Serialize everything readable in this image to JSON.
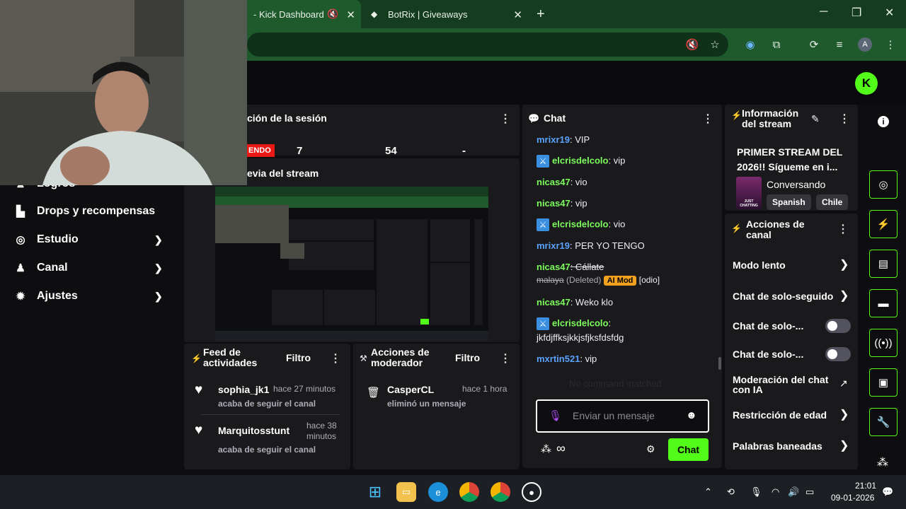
{
  "browser": {
    "tabs": [
      {
        "title": "- Kick Dashboard",
        "active": true
      },
      {
        "title": "BotRix | Giveaways",
        "active": false
      }
    ],
    "new_tab": "+",
    "avatar_letter": "A",
    "window_controls": {
      "minimize": "─",
      "maximize": "❐",
      "close": "✕"
    }
  },
  "kick": {
    "logo_letter": "K"
  },
  "sidebar": {
    "items": [
      {
        "label": "Logros",
        "icon": "trophy-icon"
      },
      {
        "label": "Drops y recompensas",
        "icon": "gift-icon"
      },
      {
        "label": "Estudio",
        "icon": "studio-icon"
      },
      {
        "label": "Canal",
        "icon": "user-icon"
      },
      {
        "label": "Ajustes",
        "icon": "gear-icon"
      }
    ]
  },
  "session": {
    "title": "ción de la sesión",
    "live_label": "ENDO",
    "stat1": "7",
    "stat2": "54",
    "stat3": "-"
  },
  "preview": {
    "title": "evia del stream"
  },
  "chat": {
    "title": "Chat",
    "messages": [
      {
        "user": "mrixr19",
        "text": ": VIP"
      },
      {
        "user": "elcrisdelcolo",
        "text": ": vip"
      },
      {
        "user": "nicas47",
        "text": ": vio"
      },
      {
        "user": "nicas47",
        "text": ": vip"
      },
      {
        "user": "elcrisdelcolo",
        "text": ": vio"
      },
      {
        "user": "mrixr19",
        "text": ": PER YO TENGO"
      },
      {
        "user": "nicas47",
        "text": ": Cállate"
      },
      {
        "deleted_text": "malaya",
        "deleted_label": "(Deleted)",
        "badge": "AI Mod",
        "reason": "[odio]"
      },
      {
        "user": "nicas47",
        "text": ": Weko klo"
      },
      {
        "user": "elcrisdelcolo",
        "text": ":"
      },
      {
        "text": "jkfdjffksjkkjsfjksfdsfdg"
      },
      {
        "user": "mxrtin521",
        "text": ": vip"
      }
    ],
    "faded_line": "No command matched",
    "input_placeholder": "Enviar un mensaje",
    "send_label": "Chat"
  },
  "feed": {
    "title_line1": "Feed de",
    "title_line2": "actividades",
    "filter": "Filtro",
    "items": [
      {
        "name": "sophia_jk1",
        "time": "hace 27 minutos",
        "action": "acaba de seguir el canal"
      },
      {
        "name": "Marquitosstunt",
        "time_line1": "hace 38",
        "time_line2": "minutos",
        "action": "acaba de seguir el canal"
      }
    ]
  },
  "mod_actions": {
    "title_line1": "Acciones de",
    "title_line2": "moderador",
    "filter": "Filtro",
    "items": [
      {
        "name": "CasperCL",
        "time": "hace 1 hora",
        "action": "eliminó un mensaje"
      }
    ]
  },
  "stream_info": {
    "title_line1": "Información",
    "title_line2": "del stream",
    "stream_title_line1": "PRIMER STREAM DEL",
    "stream_title_line2": "2026!! Sígueme en i...",
    "category": "Conversando",
    "category_thumb_text": "JUST CHATTING",
    "tags": [
      "Spanish",
      "Chile"
    ]
  },
  "channel_actions": {
    "title_line1": "Acciones de",
    "title_line2": "canal",
    "items": [
      {
        "label": "Modo lento",
        "control": "chevron"
      },
      {
        "label": "Chat de solo-seguido",
        "control": "chevron"
      },
      {
        "label": "Chat de solo-...",
        "control": "toggle"
      },
      {
        "label": "Chat de solo-...",
        "control": "toggle"
      },
      {
        "label_line1": "Moderación del chat",
        "label_line2": "con IA",
        "control": "external"
      },
      {
        "label": "Restricción de edad",
        "control": "chevron"
      },
      {
        "label": "Palabras baneadas",
        "control": "chevron"
      }
    ]
  },
  "taskbar": {
    "time": "21:01",
    "date": "09-01-2026"
  }
}
